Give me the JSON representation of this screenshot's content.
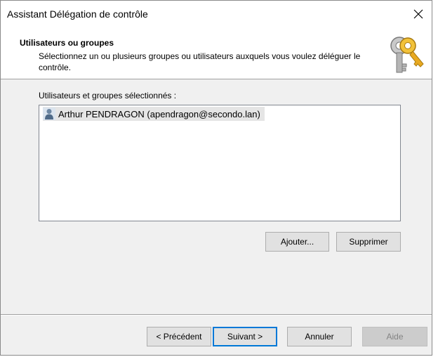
{
  "window": {
    "title": "Assistant Délégation de contrôle",
    "close_icon": "close-icon"
  },
  "header": {
    "heading": "Utilisateurs ou groupes",
    "description": "Sélectionnez un ou plusieurs groupes ou utilisateurs auxquels vous voulez déléguer le contrôle.",
    "icon": "keys-icon"
  },
  "list": {
    "label": "Utilisateurs et groupes sélectionnés :",
    "items": [
      {
        "icon": "user-icon",
        "label": "Arthur PENDRAGON (apendragon@secondo.lan)"
      }
    ]
  },
  "buttons": {
    "add": "Ajouter...",
    "remove": "Supprimer",
    "previous": "< Précédent",
    "next": "Suivant >",
    "cancel": "Annuler",
    "help": "Aide"
  },
  "colors": {
    "accent": "#0078d7",
    "dialog_bg": "#f0f0f0",
    "selection_bg": "#e5e5e5"
  }
}
